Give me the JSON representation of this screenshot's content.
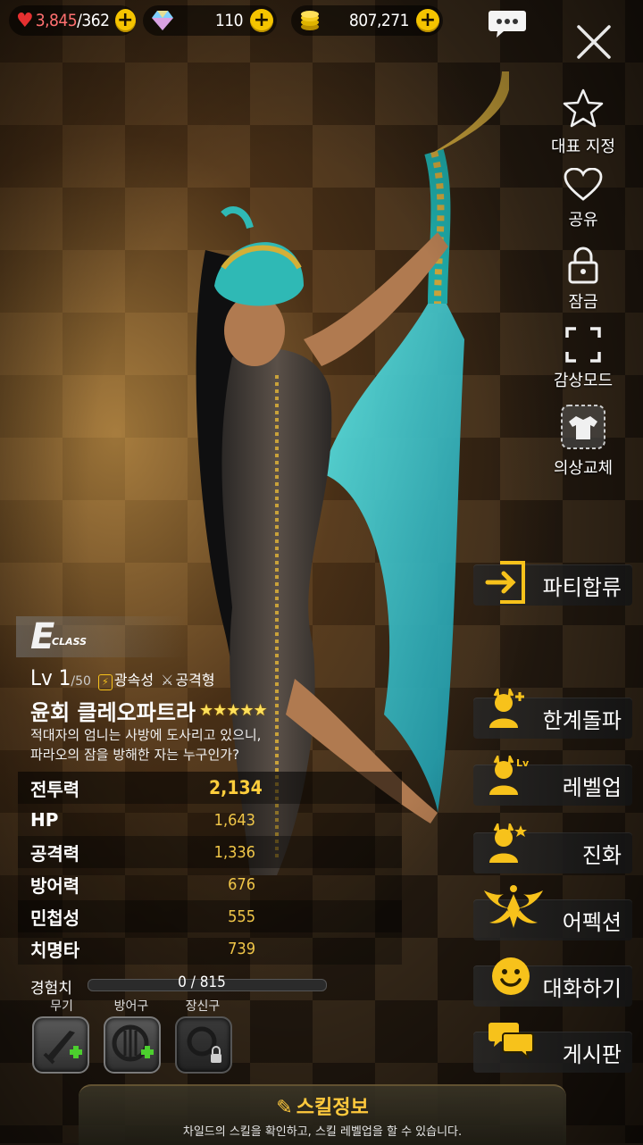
{
  "topbar": {
    "stamina": "3,845",
    "stamina_max": "/362",
    "gems": "110",
    "gold": "807,271"
  },
  "side_menu": [
    {
      "label": "대표 지정",
      "icon": "star-outline-icon"
    },
    {
      "label": "공유",
      "icon": "heart-outline-icon"
    },
    {
      "label": "잠금",
      "icon": "lock-icon"
    },
    {
      "label": "감상모드",
      "icon": "fullscreen-icon"
    },
    {
      "label": "의상교체",
      "icon": "costume-icon"
    }
  ],
  "actions": [
    {
      "label": "파티합류",
      "icon": "enter-party-icon"
    },
    {
      "label": "한계돌파",
      "icon": "limit-break-icon"
    },
    {
      "label": "레벨업",
      "icon": "level-up-icon"
    },
    {
      "label": "진화",
      "icon": "evolve-icon"
    },
    {
      "label": "어펙션",
      "icon": "affection-icon"
    },
    {
      "label": "대화하기",
      "icon": "smile-icon"
    },
    {
      "label": "게시판",
      "icon": "board-icon"
    }
  ],
  "character": {
    "class_letter": "E",
    "class_word": "CLASS",
    "level": "Lv 1",
    "level_max": "/50",
    "element": "광속성",
    "type": "공격형",
    "name": "윤회 클레오파트라",
    "stars": "★★★★★",
    "description_line1": "적대자의 엄니는 사방에 도사리고 있으니,",
    "description_line2": "파라오의 잠을 방해한 자는 누구인가?"
  },
  "stats": [
    {
      "label": "전투력",
      "value": "2,134"
    },
    {
      "label": "HP",
      "value": "1,643"
    },
    {
      "label": "공격력",
      "value": "1,336"
    },
    {
      "label": "방어력",
      "value": "676"
    },
    {
      "label": "민첩성",
      "value": "555"
    },
    {
      "label": "치명타",
      "value": "739"
    }
  ],
  "experience": {
    "label": "경험치",
    "value": "0 / 815",
    "progress": 0
  },
  "equipment": [
    {
      "label": "무기"
    },
    {
      "label": "방어구"
    },
    {
      "label": "장신구"
    }
  ],
  "skill": {
    "title": "스킬정보",
    "subtitle": "차일드의 스킬을 확인하고, 스킬 레벨업을 할 수 있습니다."
  }
}
